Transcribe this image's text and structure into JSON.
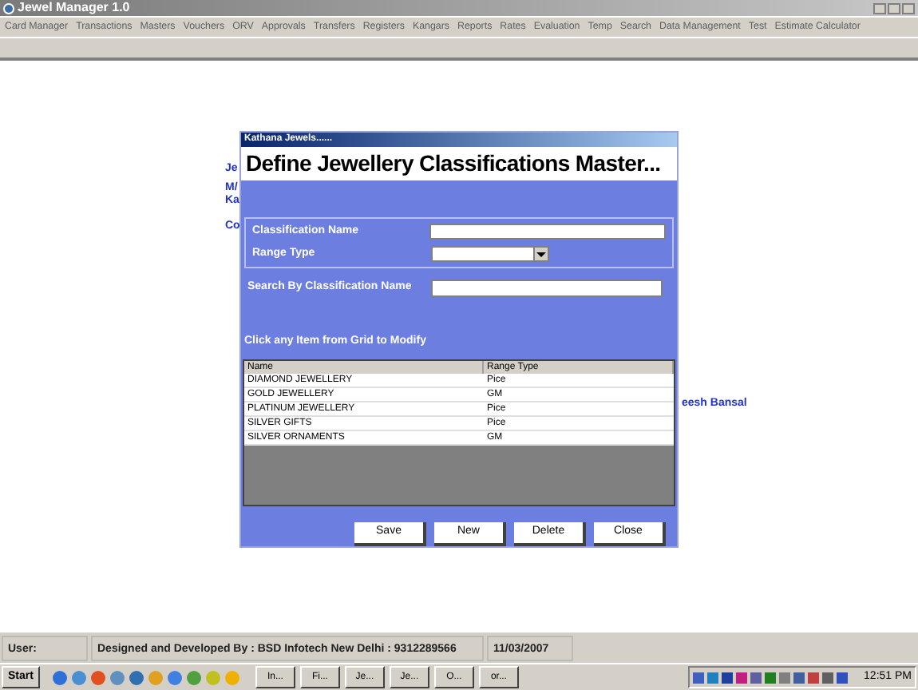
{
  "window": {
    "title": "Jewel Manager 1.0"
  },
  "menu": [
    "Card Manager",
    "Transactions",
    "Masters",
    "Vouchers",
    "ORV",
    "Approvals",
    "Transfers",
    "Registers",
    "Kangars",
    "Reports",
    "Rates",
    "Evaluation",
    "Temp",
    "Search",
    "Data Management",
    "Test",
    "Estimate Calculator"
  ],
  "background_texts": [
    "Je",
    "M/",
    "Ka",
    "Co",
    "eesh Bansal"
  ],
  "dialog": {
    "caption": "Kathana Jewels......",
    "heading": "Define Jewellery Classifications Master...",
    "fields": [
      {
        "kind": "text",
        "label": "Classification Name"
      },
      {
        "kind": "dropdown",
        "label": "Range Type"
      }
    ],
    "search": {
      "label": "Search By Classification Name"
    },
    "grid_hint": "Click any Item from Grid to Modify",
    "table": {
      "columns": [
        "Name",
        "Range Type"
      ],
      "rows": [
        [
          "DIAMOND JEWELLERY",
          "Pice"
        ],
        [
          "GOLD JEWELLERY",
          "GM"
        ],
        [
          "PLATINUM JEWELLERY",
          "Pice"
        ],
        [
          "SILVER GIFTS",
          "Pice"
        ],
        [
          "SILVER ORNAMENTS",
          "GM"
        ]
      ]
    },
    "buttons": [
      "Save",
      "New",
      "Delete",
      "Close"
    ]
  },
  "status_bar": [
    "User:",
    "Designed and Developed By : BSD Infotech New Delhi : 9312289566",
    "11/03/2007"
  ],
  "taskbar": {
    "start": "Start",
    "tasks": [
      "In...",
      "Fi...",
      "Je...",
      "Je...",
      "O...",
      "or..."
    ],
    "clock": "12:51 PM"
  }
}
